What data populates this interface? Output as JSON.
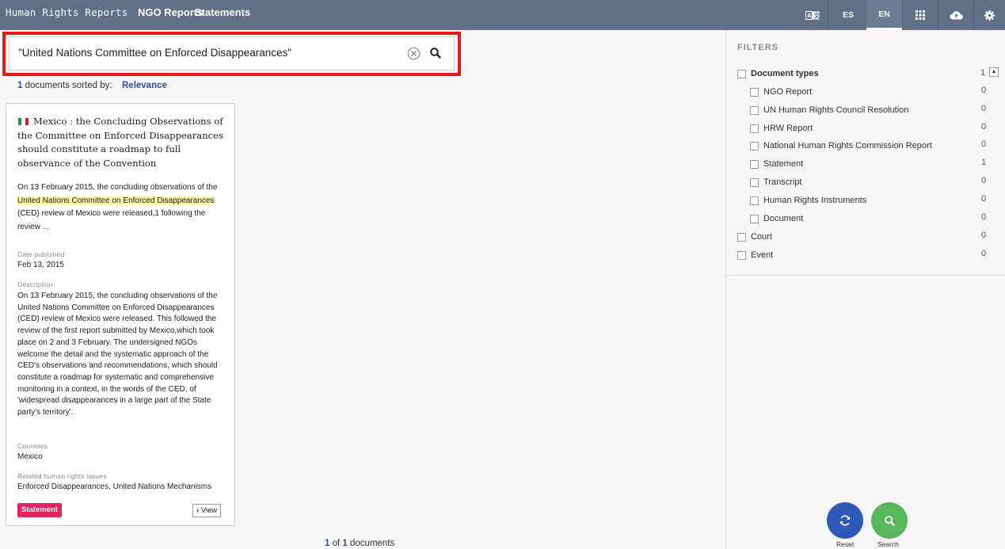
{
  "nav": {
    "brand": "Human Rights Reports",
    "links": [
      "NGO Reports",
      "Statements"
    ],
    "translate_icon": "translate-icon",
    "lang_es": "ES",
    "lang_en": "EN",
    "icons": [
      "grid-icon",
      "cloud-upload-icon",
      "gear-icon"
    ]
  },
  "search": {
    "value": "\"United Nations Committee on Enforced Disappearances\"",
    "clear_icon": "clear-circle-icon",
    "search_icon": "search-icon"
  },
  "results": {
    "count": "1",
    "sorted_by_label": "documents sorted by:",
    "sort_value": "Relevance"
  },
  "card": {
    "flag_icon": "mexico-flag-icon",
    "title": "Mexico : the Concluding Observations of the Committee on Enforced Disappearances should constitute a roadmap to full observance of the Convention",
    "snippet_before": "On 13 February 2015, the concluding observations of the ",
    "snippet_highlight": "United Nations Committee on Enforced Disappearances",
    "snippet_after": " (CED) review of Mexico were released,1 following the review ...",
    "date_label": "Date published",
    "date_value": "Feb 13, 2015",
    "description_label": "Description",
    "description": "On 13 February 2015, the concluding observations of the United Nations Committee on Enforced Disappearances (CED) review of Mexico were released. This followed the review of the first report submitted by Mexico,which took place on 2 and 3 February. The undersigned NGOs welcome the detail and the systematic approach of the CED's observations and recommendations, which should constitute a roadmap for systematic and comprehensive monitoring in a context, in the words of the CED, of 'widespread disappearances in a large part of the State party's territory'.",
    "countries_label": "Countries",
    "countries_value": "Mexico",
    "issues_label": "Related human rights issues",
    "issues_value": "Enforced Disappearances, United Nations Mechanisms",
    "badge": "Statement",
    "view_label": "View"
  },
  "footer": {
    "current": "1",
    "of_label": "of",
    "total": "1",
    "documents_label": "documents"
  },
  "filters": {
    "title": "FILTERS",
    "groups": [
      {
        "label": "Document types",
        "count": "1",
        "bold": true
      },
      {
        "label": "NGO Report",
        "count": "0"
      },
      {
        "label": "UN Human Rights Council Resolution",
        "count": "0"
      },
      {
        "label": "HRW Report",
        "count": "0"
      },
      {
        "label": "National Human Rights Commission Report",
        "count": "0"
      },
      {
        "label": "Statement",
        "count": "1"
      },
      {
        "label": "Transcript",
        "count": "0"
      },
      {
        "label": "Human Rights Instruments",
        "count": "0"
      },
      {
        "label": "Document",
        "count": "0"
      },
      {
        "label": "Court",
        "count": "0"
      },
      {
        "label": "Event",
        "count": "0"
      }
    ],
    "collapse_icon": "collapse-up-icon"
  },
  "actions": {
    "reset_label": "Reset",
    "search_label": "Search",
    "reset_icon": "refresh-icon",
    "search_icon": "search-icon"
  },
  "colors": {
    "navbar": "#5f7087",
    "highlight_border": "#e31b1b",
    "link_blue": "#2b4f9e",
    "badge": "#e0245e",
    "reset_button": "#2f57b8",
    "search_button": "#56b85a"
  }
}
